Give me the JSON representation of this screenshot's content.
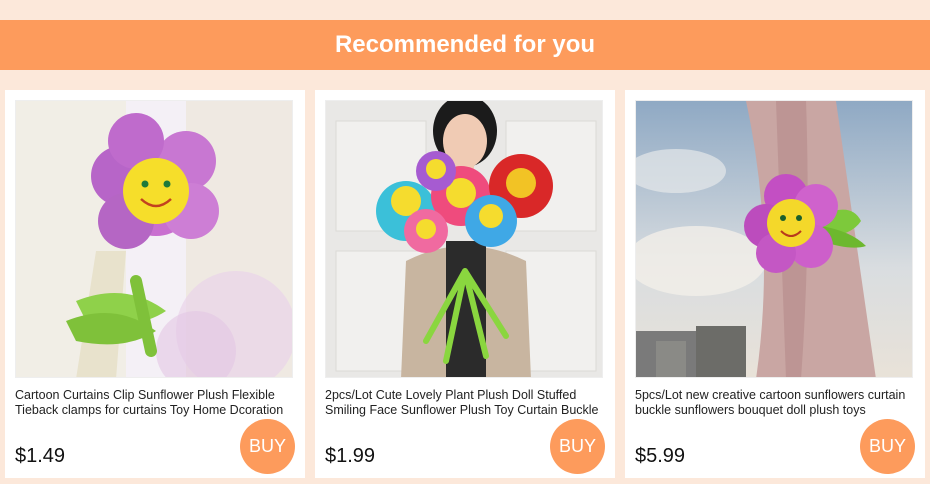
{
  "header": {
    "title": "Recommended for you"
  },
  "products": [
    {
      "title": "Cartoon Curtains Clip Sunflower Plush Flexible Tieback clamps for curtains Toy Home Dcoration",
      "price": "$1.49",
      "buy_label": "BUY"
    },
    {
      "title": "2pcs/Lot Cute Lovely Plant Plush Doll Stuffed Smiling Face Sunflower Plush Toy Curtain Buckle",
      "price": "$1.99",
      "buy_label": "BUY"
    },
    {
      "title": "5pcs/Lot new creative cartoon sunflowers curtain buckle sunflowers bouquet doll plush toys",
      "price": "$5.99",
      "buy_label": "BUY"
    }
  ],
  "colors": {
    "accent": "#fd9b5c",
    "background": "#fce8da"
  }
}
